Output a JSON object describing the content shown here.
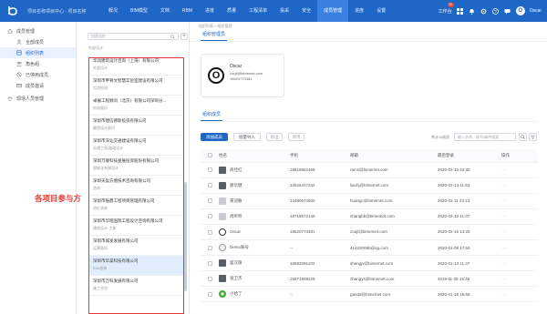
{
  "topnav": {
    "project_name": "项目名称项目中心 · 项目名称",
    "items": [
      "概况",
      "BIM模型",
      "文档",
      "RBM",
      "进度",
      "质量",
      "工程清单",
      "投采",
      "安全",
      "成员管理",
      "进度",
      "设置"
    ],
    "active_index": 9,
    "workspace_label": "工作台",
    "notification_count": "20",
    "user_initial": "O",
    "user_name": "Oscar"
  },
  "sidebar": {
    "items": [
      {
        "label": "成员管理",
        "icon": "home-icon",
        "sub": false
      },
      {
        "label": "全部成员",
        "icon": "user-icon",
        "sub": true
      },
      {
        "label": "组织列表",
        "icon": "org-icon",
        "sub": true
      },
      {
        "label": "角色组",
        "icon": "role-icon",
        "sub": true
      },
      {
        "label": "已停用成员",
        "icon": "block-icon",
        "sub": true
      },
      {
        "label": "成员邀请",
        "icon": "invite-icon",
        "sub": true
      },
      {
        "label": "现场人员管理",
        "icon": "worker-icon",
        "sub": false
      }
    ],
    "active_index": 2
  },
  "company_panel": {
    "search_placeholder": "搜索组织",
    "preview_text": "外部设计",
    "companies": [
      {
        "name": "华润建筑设计咨询（上海）有限公司",
        "type": "外部设计"
      },
      {
        "name": "深圳市甲骨文智慧实验室建设有限公司",
        "type": "实验检测"
      },
      {
        "name": "卓展工程顾问（北京）有限公司深圳分...",
        "type": "机电顾问"
      },
      {
        "name": "深圳市建信德斯投资有限公司",
        "type": "幕墙设计顾问"
      },
      {
        "name": "深圳市深汕交通建设有限公司",
        "type": "交通工程/路政设计"
      },
      {
        "name": "深圳万联科技发展投资股份有限公司",
        "type": "智能化系统设计"
      },
      {
        "name": "深圳天盈方德技术咨询有限公司",
        "type": "咨询"
      },
      {
        "name": "深圳市振鼎工程项目管理有限公司",
        "type": "造价咨询"
      },
      {
        "name": "深圳市华昭国际工程设计咨询有限公司",
        "type": "建筑设计-主体"
      },
      {
        "name": "深圳市城发发展有限公司",
        "type": "运营顾问"
      },
      {
        "name": "深圳市华美科技有限公司",
        "type": "BIM咨询"
      },
      {
        "name": "深圳市万科发展有限公司",
        "type": "施工总包"
      }
    ],
    "active_index": 10,
    "annotation": "各项目参与方"
  },
  "main": {
    "breadcrumb": "组织列表 > 组织管理",
    "tab1": "组织管理员",
    "org": {
      "initial": "O",
      "name": "Oscar",
      "email": "zoujl@bimemet.com",
      "phone": "18620773381"
    },
    "tab2": "组织成员",
    "toolbar": {
      "add": "添加成员",
      "import": "批量导入",
      "b3": "移出",
      "b4": "停用",
      "count": "共计11成员",
      "search_placeholder": "输入名称、帐号/邮件搜索"
    },
    "table": {
      "headers": [
        "姓名",
        "手机",
        "邮箱",
        "最后登录",
        "操作"
      ],
      "rows": [
        {
          "avatar": "dark",
          "name": "商佳红",
          "phone": "18616682466",
          "email": "rams@bimemet.com",
          "last": "2020-02-13 22:30"
        },
        {
          "avatar": "dark",
          "name": "廖华健",
          "phone": "13526427332",
          "email": "liaohj@bimemet.com",
          "last": "2020-02-13 11:53"
        },
        {
          "avatar": "light",
          "name": "黄冠敏",
          "phone": "13480672600",
          "email": "huangc@bimemet.com",
          "last": "2020-02-11 23:13"
        },
        {
          "avatar": "light",
          "name": "尚昕昕",
          "phone": "18718672140",
          "email": "shangbb@bimemet.com",
          "last": "2020-02-13 11:37"
        },
        {
          "avatar": "ring",
          "name": "Oscar",
          "phone": "18620773381",
          "email": "zoujl@bimemet.com",
          "last": "2020-02-16 14:20"
        },
        {
          "avatar": "grey",
          "name": "Demo账号",
          "phone": "--",
          "email": "414220080@qq.com",
          "last": "2020-01-08 17:50"
        },
        {
          "avatar": "dark",
          "name": "盛汉旗",
          "phone": "18682091103",
          "email": "shengjv@bimemet.com",
          "last": "2020-01-13 11:37"
        },
        {
          "avatar": "dark",
          "name": "张卫杰",
          "phone": "15871808225",
          "email": "zhangys@bimemet.com",
          "last": "2019-11-26 15:45"
        },
        {
          "avatar": "green",
          "name": "小哈了",
          "phone": "--",
          "email": "gandd@bimemet.com",
          "last": "2020-01-18 16:56"
        }
      ]
    }
  }
}
